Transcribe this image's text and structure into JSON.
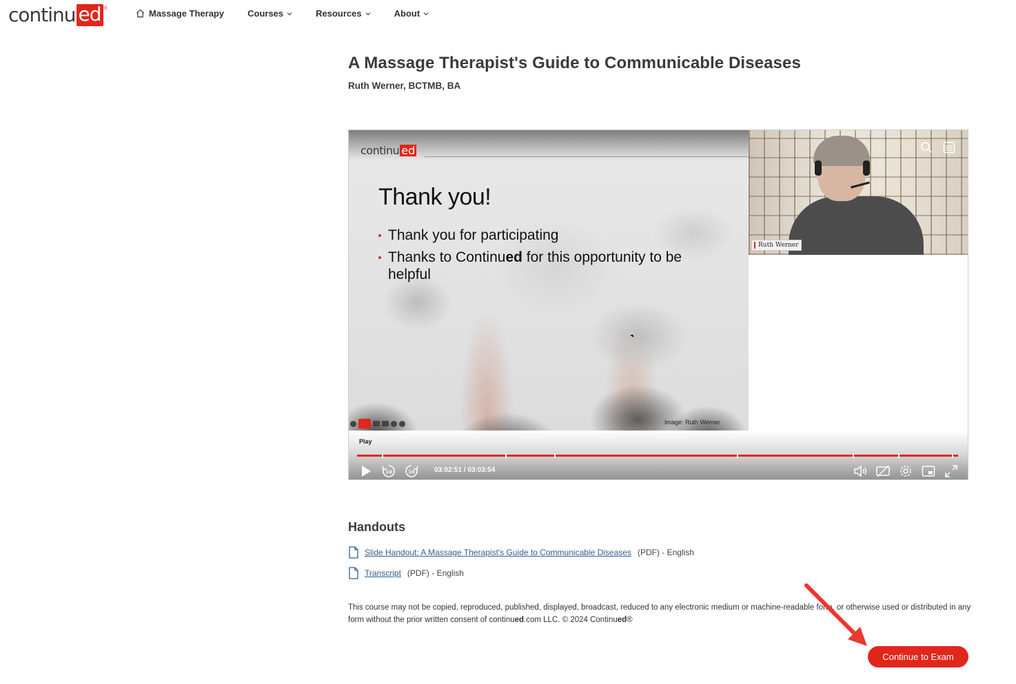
{
  "brand": {
    "logo_part1": "continu",
    "logo_part2": "ed",
    "logo_reg": "®",
    "accent_color": "#e1261c"
  },
  "nav": {
    "items": [
      {
        "label": "Massage Therapy",
        "icon": "home-icon"
      },
      {
        "label": "Courses",
        "icon": "chevron-down-icon"
      },
      {
        "label": "Resources",
        "icon": "chevron-down-icon"
      },
      {
        "label": "About",
        "icon": "chevron-down-icon"
      }
    ]
  },
  "course": {
    "title": "A Massage Therapist's Guide to Communicable Diseases",
    "author": "Ruth Werner, BCTMB, BA"
  },
  "slide": {
    "logo_part1": "continu",
    "logo_part2": "ed",
    "heading": "Thank you!",
    "bullets": [
      {
        "pre": "Thank you for participating",
        "bold": "",
        "post": ""
      },
      {
        "pre": "Thanks to Continu",
        "bold": "ed",
        "post": " for this opportunity to be helpful"
      }
    ],
    "image_caption": "Image: Ruth Werner"
  },
  "webcam": {
    "name_tag": "Ruth Werner"
  },
  "player": {
    "play_label": "Play",
    "time_current": "03:02:51",
    "time_total": "03:03:54",
    "time_display": "03:02:51 / 03:03:54",
    "progress_fraction": 0.99
  },
  "handouts": {
    "title": "Handouts",
    "items": [
      {
        "link": "Slide Handout: A Massage Therapist's Guide to Communicable Diseases",
        "meta": "(PDF) - English"
      },
      {
        "link": "Transcript",
        "meta": "(PDF) - English"
      }
    ]
  },
  "legal": {
    "text_a": "This course may not be copied, reproduced, published, displayed, broadcast, reduced to any electronic medium or machine-readable form, or otherwise used or distributed in any form without the prior written consent of continu",
    "bold_a": "ed",
    "text_b": ".com LLC. © 2024 Continu",
    "bold_b": "ed",
    "text_c": "®"
  },
  "cta": {
    "label": "Continue to Exam"
  }
}
